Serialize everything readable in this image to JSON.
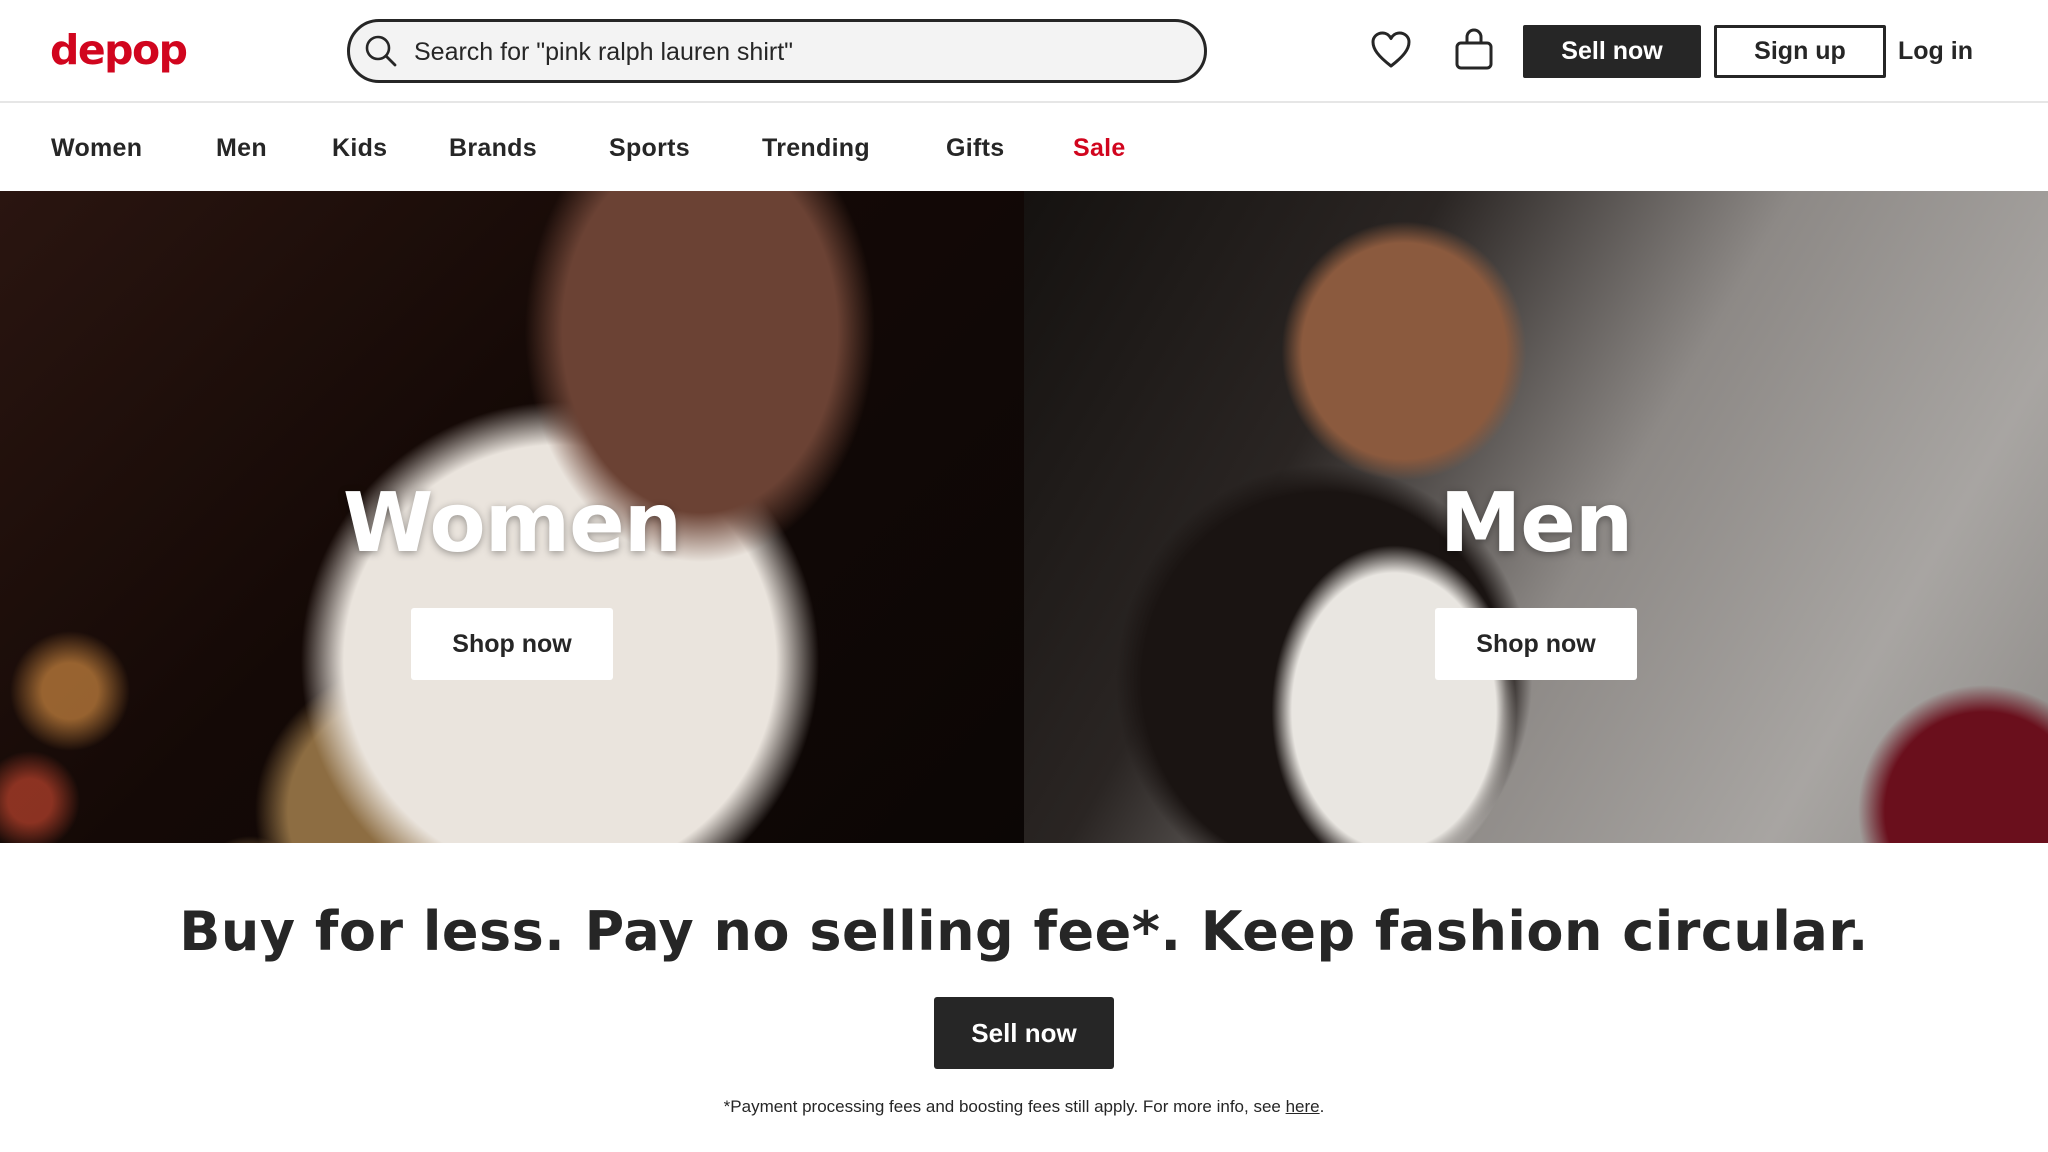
{
  "header": {
    "logo": "depop",
    "search": {
      "placeholder": "Search for \"pink ralph lauren shirt\""
    },
    "icons": {
      "search": "search-icon",
      "likes": "heart-icon",
      "bag": "bag-icon"
    },
    "sell_now": "Sell now",
    "sign_up": "Sign up",
    "log_in": "Log in"
  },
  "nav": {
    "items": [
      {
        "label": "Women"
      },
      {
        "label": "Men"
      },
      {
        "label": "Kids"
      },
      {
        "label": "Brands"
      },
      {
        "label": "Sports"
      },
      {
        "label": "Trending"
      },
      {
        "label": "Gifts"
      },
      {
        "label": "Sale"
      }
    ]
  },
  "hero": {
    "women": {
      "title": "Women",
      "cta": "Shop now"
    },
    "men": {
      "title": "Men",
      "cta": "Shop now"
    }
  },
  "promo": {
    "headline": "Buy for less. Pay no selling fee*. Keep fashion circular.",
    "cta": "Sell now",
    "footnote": "*Payment processing fees and boosting fees still apply. For more info, see ",
    "footnote_link": "here",
    "footnote_end": "."
  },
  "colors": {
    "brand": "#d1051e",
    "ink": "#262626",
    "sale": "#d1051e"
  }
}
